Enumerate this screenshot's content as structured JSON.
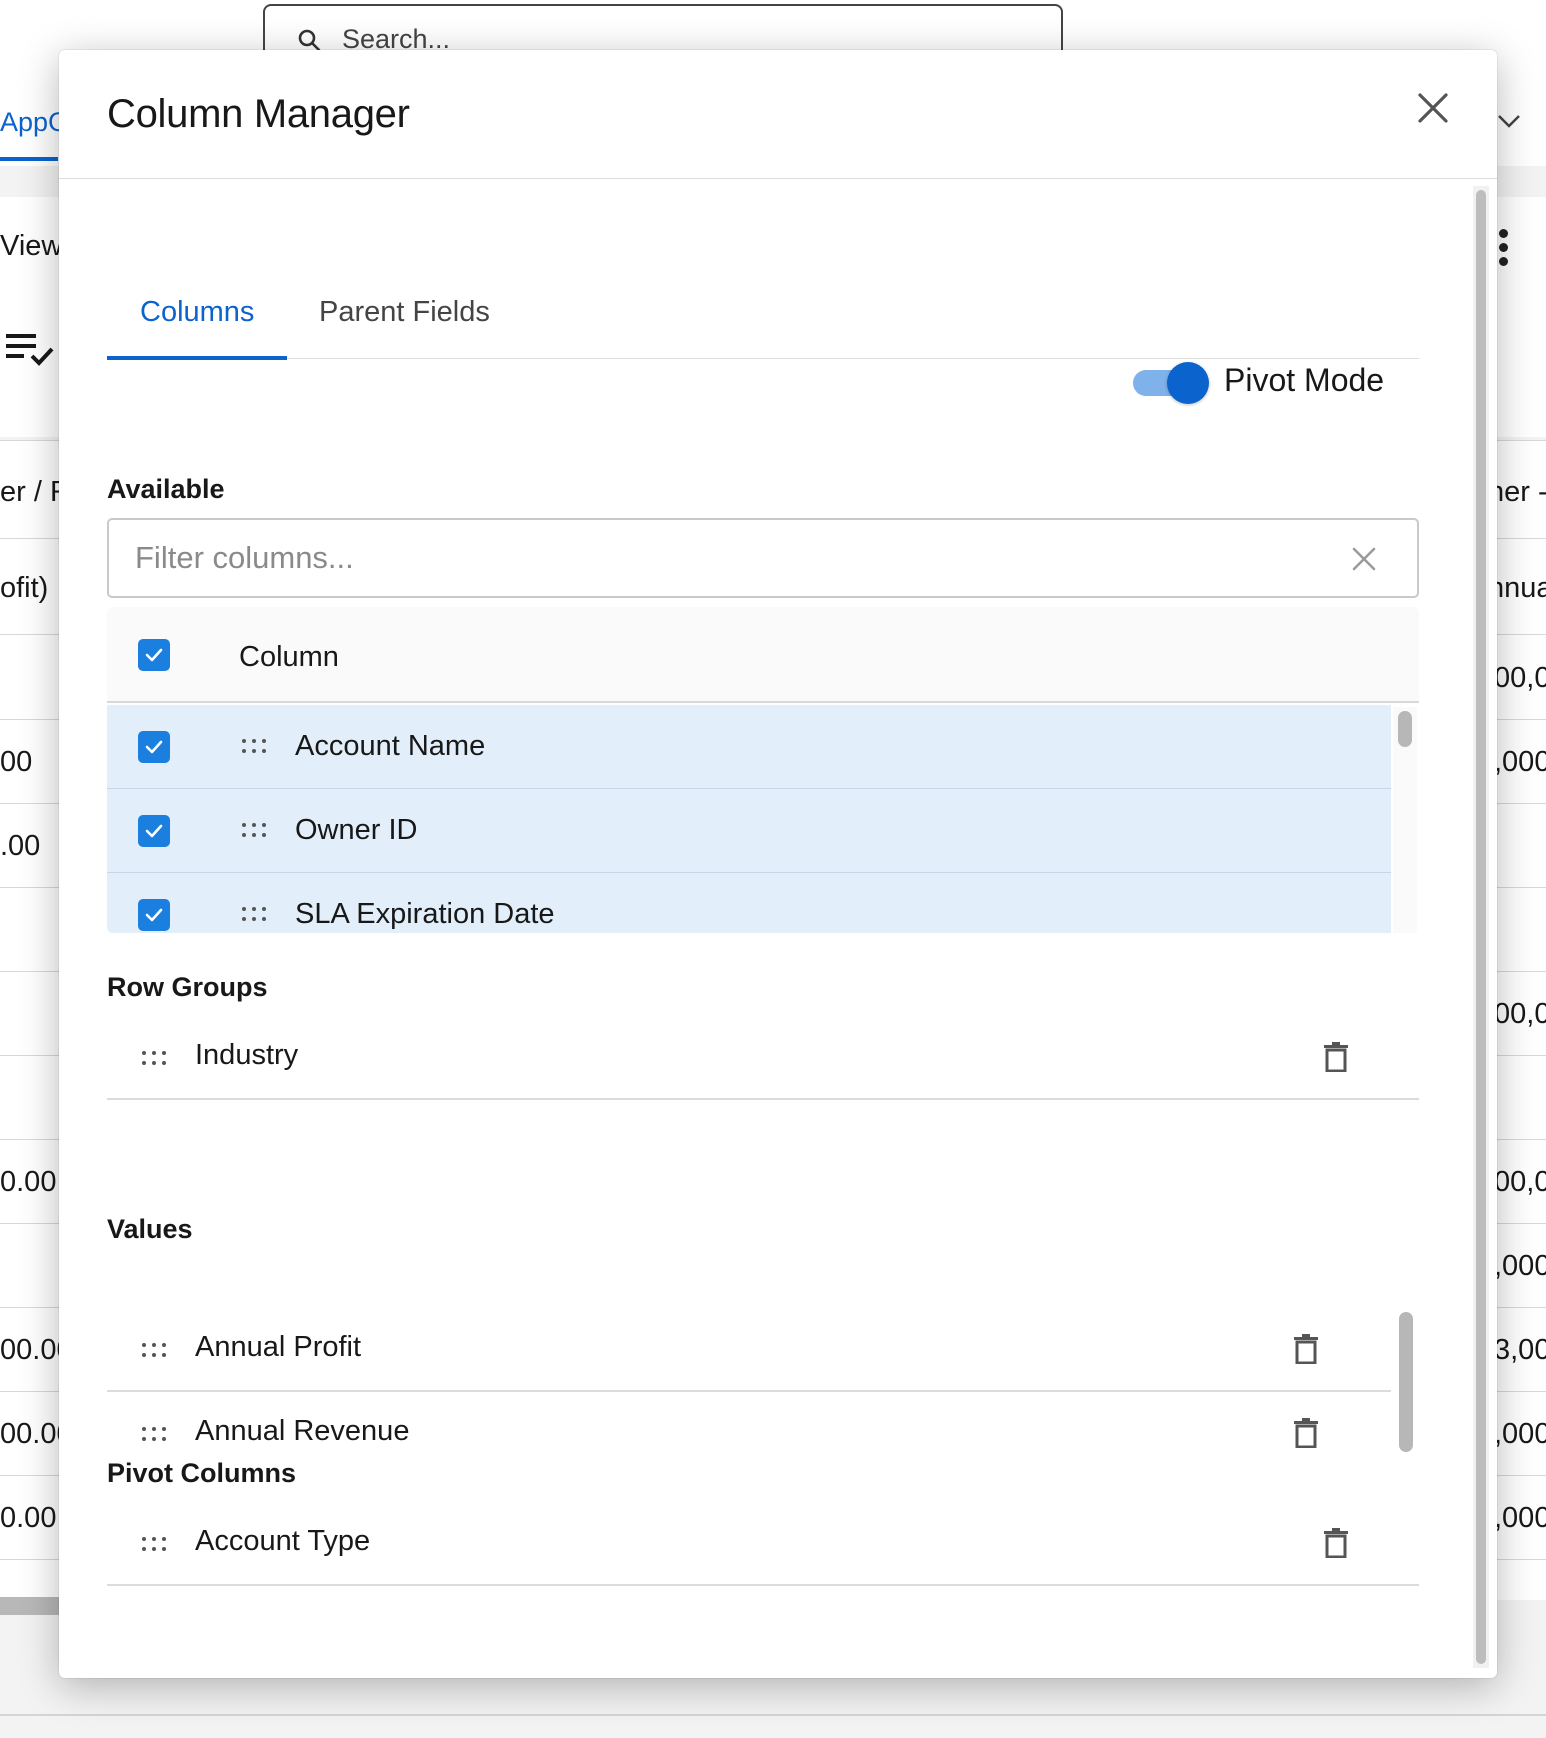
{
  "background": {
    "search_placeholder": "Search...",
    "tab_label": "AppG",
    "view_label": "View",
    "header_left": "er / R",
    "header_right": "ner -",
    "subheader_left": "ofit)",
    "subheader_right": "nnua",
    "left_cells": [
      "00",
      ".00",
      "0.00",
      "00.00",
      "00.00",
      "0.00"
    ],
    "right_cells": [
      "00,0",
      ",000",
      "00,0",
      "00,0",
      ",000",
      "3,00",
      ",000",
      ",000"
    ]
  },
  "modal": {
    "title": "Column Manager",
    "close_label": "Close",
    "tabs": [
      {
        "label": "Columns",
        "active": true
      },
      {
        "label": "Parent Fields",
        "active": false
      }
    ],
    "pivot_mode": {
      "label": "Pivot Mode",
      "on": true
    },
    "available": {
      "label": "Available",
      "filter_placeholder": "Filter columns...",
      "filter_value": "",
      "header_label": "Column",
      "header_checked": true,
      "columns": [
        {
          "label": "Account Name",
          "checked": true
        },
        {
          "label": "Owner ID",
          "checked": true
        },
        {
          "label": "SLA Expiration Date",
          "checked": true
        }
      ]
    },
    "row_groups": {
      "label": "Row Groups",
      "items": [
        "Industry"
      ]
    },
    "values": {
      "label": "Values",
      "items": [
        "Annual Profit",
        "Annual Revenue"
      ]
    },
    "pivot_columns": {
      "label": "Pivot Columns",
      "items": [
        "Account Type"
      ]
    }
  },
  "colors": {
    "accent": "#0b63ce",
    "checkbox": "#1b7fe0",
    "row_selected": "#e2effb",
    "toggle_track": "#7fb1ea"
  }
}
